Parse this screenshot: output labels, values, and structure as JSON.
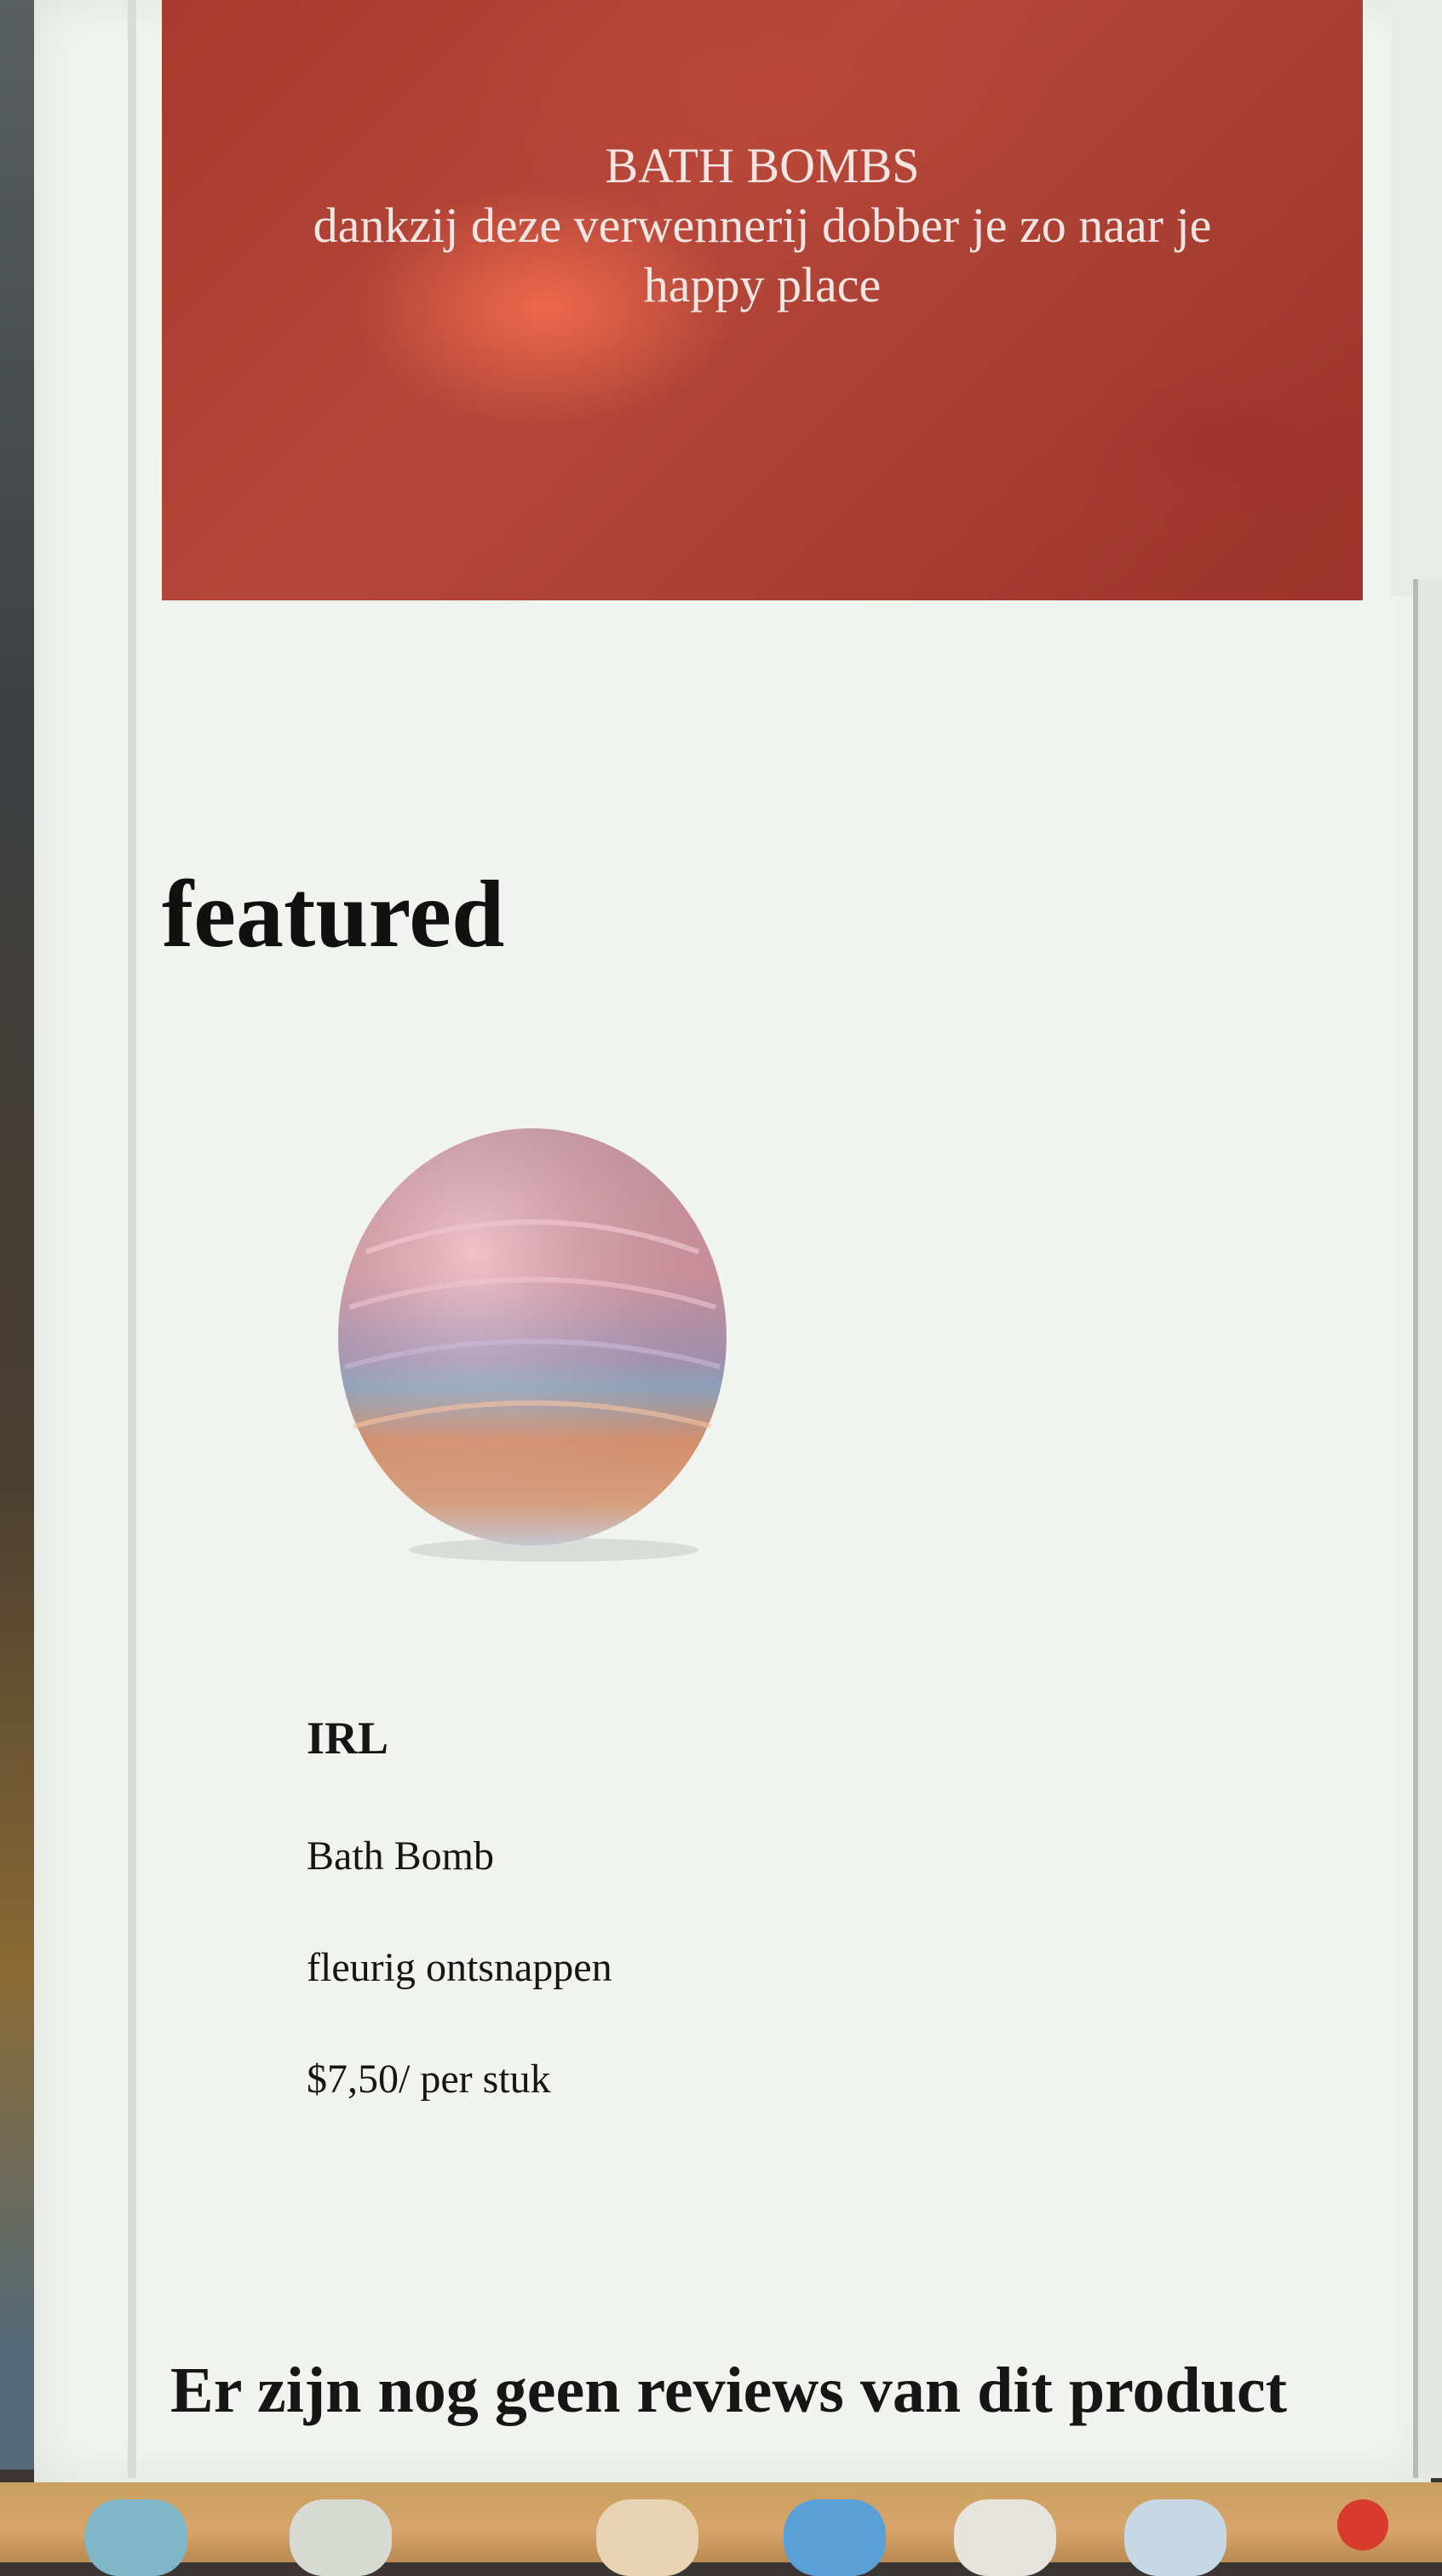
{
  "hero": {
    "title": "BATH BOMBS",
    "subtitle": "dankzij deze verwennerij dobber je zo naar je happy place"
  },
  "section": {
    "title": "featured"
  },
  "product": {
    "image_icon": "bath-bomb-image",
    "brand": "IRL",
    "type": "Bath Bomb",
    "name": "fleurig ontsnappen",
    "price": "$7,50/ per stuk"
  },
  "reviews": {
    "message": "Er zijn nog geen reviews van dit product"
  },
  "colors": {
    "hero_bg": "#a93a2d",
    "page_bg": "#f1f3ee",
    "text": "#111111"
  }
}
